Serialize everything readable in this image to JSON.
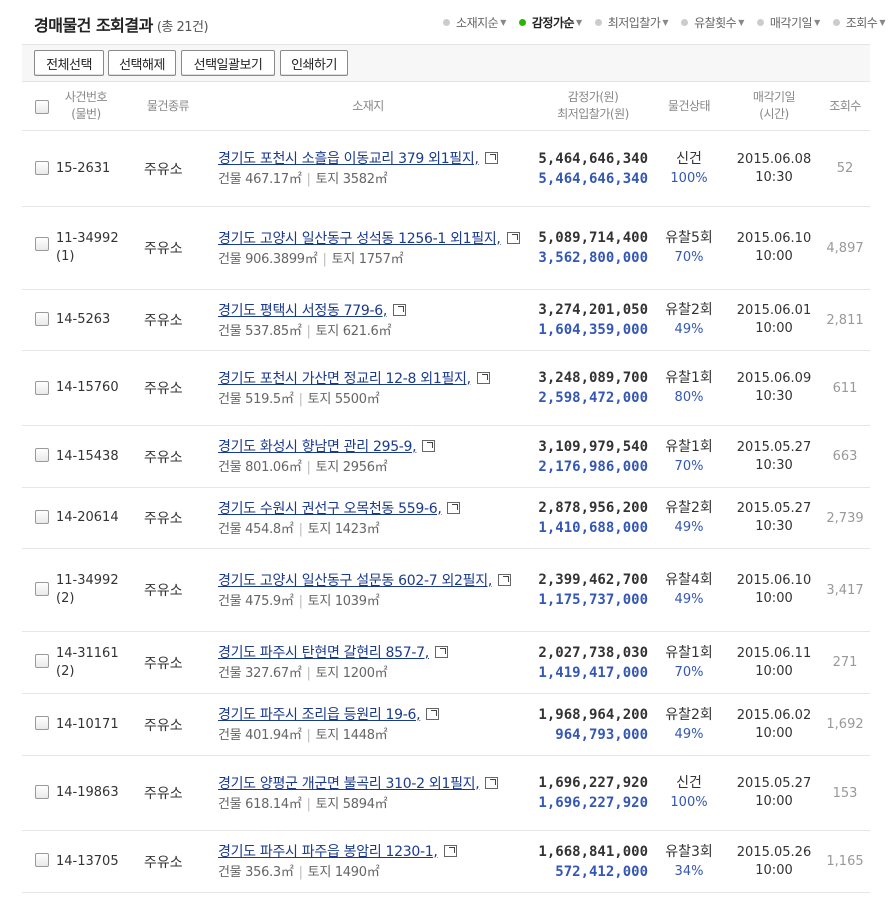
{
  "header": {
    "title": "경매물건 조회결과",
    "count": "(총 21건)",
    "sorts": [
      {
        "label": "소재지순",
        "active": false
      },
      {
        "label": "감정가순",
        "active": true
      },
      {
        "label": "최저입찰가",
        "active": false
      },
      {
        "label": "유찰횟수",
        "active": false
      },
      {
        "label": "매각기일",
        "active": false
      },
      {
        "label": "조회수",
        "active": false
      }
    ]
  },
  "toolbar": {
    "select_all": "전체선택",
    "deselect": "선택해제",
    "view_selected": "선택일괄보기",
    "print": "인쇄하기"
  },
  "columns": {
    "case_no_1": "사건번호",
    "case_no_2": "(물번)",
    "kind": "물건종류",
    "location": "소재지",
    "price_1": "감정가(원)",
    "price_2": "최저입찰가(원)",
    "status": "물건상태",
    "date_1": "매각기일",
    "date_2": "(시간)",
    "views": "조회수"
  },
  "colors": {
    "link": "#1a3a8f",
    "price_blue": "#3457b5",
    "active_dot": "#2db400"
  },
  "rows": [
    {
      "case_no": "15-2631",
      "sub": "",
      "kind": "주유소",
      "address": "경기도 포천시 소흘읍 이동교리 379 외1필지,",
      "building": "건물 467.17㎡",
      "land": "토지 3582㎡",
      "appraisal": "5,464,646,340",
      "min_bid": "5,464,646,340",
      "status": "신건",
      "ratio": "100%",
      "date": "2015.06.08",
      "time": "10:30",
      "views": "52"
    },
    {
      "case_no": "11-34992",
      "sub": "(1)",
      "kind": "주유소",
      "address": "경기도 고양시 일산동구 성석동 1256-1 외1필지,",
      "building": "건물 906.3899㎡",
      "land": "토지 1757㎡",
      "appraisal": "5,089,714,400",
      "min_bid": "3,562,800,000",
      "status": "유찰5회",
      "ratio": "70%",
      "date": "2015.06.10",
      "time": "10:00",
      "views": "4,897"
    },
    {
      "case_no": "14-5263",
      "sub": "",
      "kind": "주유소",
      "address": "경기도 평택시 서정동 779-6,",
      "building": "건물 537.85㎡",
      "land": "토지 621.6㎡",
      "appraisal": "3,274,201,050",
      "min_bid": "1,604,359,000",
      "status": "유찰2회",
      "ratio": "49%",
      "date": "2015.06.01",
      "time": "10:00",
      "views": "2,811"
    },
    {
      "case_no": "14-15760",
      "sub": "",
      "kind": "주유소",
      "address": "경기도 포천시 가산면 정교리 12-8 외1필지,",
      "building": "건물 519.5㎡",
      "land": "토지 5500㎡",
      "appraisal": "3,248,089,700",
      "min_bid": "2,598,472,000",
      "status": "유찰1회",
      "ratio": "80%",
      "date": "2015.06.09",
      "time": "10:30",
      "views": "611"
    },
    {
      "case_no": "14-15438",
      "sub": "",
      "kind": "주유소",
      "address": "경기도 화성시 향남면 관리 295-9,",
      "building": "건물 801.06㎡",
      "land": "토지 2956㎡",
      "appraisal": "3,109,979,540",
      "min_bid": "2,176,986,000",
      "status": "유찰1회",
      "ratio": "70%",
      "date": "2015.05.27",
      "time": "10:30",
      "views": "663"
    },
    {
      "case_no": "14-20614",
      "sub": "",
      "kind": "주유소",
      "address": "경기도 수원시 권선구 오목천동 559-6,",
      "building": "건물 454.8㎡",
      "land": "토지 1423㎡",
      "appraisal": "2,878,956,200",
      "min_bid": "1,410,688,000",
      "status": "유찰2회",
      "ratio": "49%",
      "date": "2015.05.27",
      "time": "10:30",
      "views": "2,739"
    },
    {
      "case_no": "11-34992",
      "sub": "(2)",
      "kind": "주유소",
      "address": "경기도 고양시 일산동구 설문동 602-7 외2필지,",
      "building": "건물 475.9㎡",
      "land": "토지 1039㎡",
      "appraisal": "2,399,462,700",
      "min_bid": "1,175,737,000",
      "status": "유찰4회",
      "ratio": "49%",
      "date": "2015.06.10",
      "time": "10:00",
      "views": "3,417"
    },
    {
      "case_no": "14-31161",
      "sub": "(2)",
      "kind": "주유소",
      "address": "경기도 파주시 탄현면 갈현리 857-7,",
      "building": "건물 327.67㎡",
      "land": "토지 1200㎡",
      "appraisal": "2,027,738,030",
      "min_bid": "1,419,417,000",
      "status": "유찰1회",
      "ratio": "70%",
      "date": "2015.06.11",
      "time": "10:00",
      "views": "271"
    },
    {
      "case_no": "14-10171",
      "sub": "",
      "kind": "주유소",
      "address": "경기도 파주시 조리읍 등원리 19-6,",
      "building": "건물 401.94㎡",
      "land": "토지 1448㎡",
      "appraisal": "1,968,964,200",
      "min_bid": "964,793,000",
      "status": "유찰2회",
      "ratio": "49%",
      "date": "2015.06.02",
      "time": "10:00",
      "views": "1,692"
    },
    {
      "case_no": "14-19863",
      "sub": "",
      "kind": "주유소",
      "address": "경기도 양평군 개군면 불곡리 310-2 외1필지,",
      "building": "건물 618.14㎡",
      "land": "토지 5894㎡",
      "appraisal": "1,696,227,920",
      "min_bid": "1,696,227,920",
      "status": "신건",
      "ratio": "100%",
      "date": "2015.05.27",
      "time": "10:00",
      "views": "153"
    },
    {
      "case_no": "14-13705",
      "sub": "",
      "kind": "주유소",
      "address": "경기도 파주시 파주읍 봉암리 1230-1,",
      "building": "건물 356.3㎡",
      "land": "토지 1490㎡",
      "appraisal": "1,668,841,000",
      "min_bid": "572,412,000",
      "status": "유찰3회",
      "ratio": "34%",
      "date": "2015.05.26",
      "time": "10:00",
      "views": "1,165"
    }
  ]
}
